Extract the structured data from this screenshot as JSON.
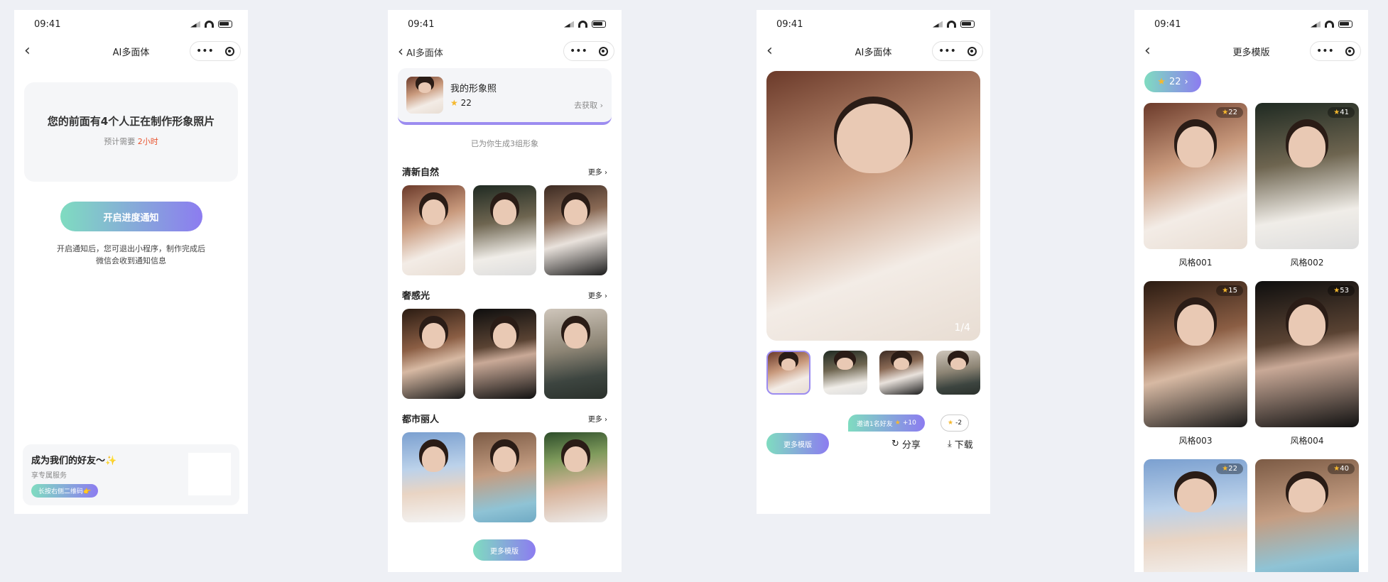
{
  "status": {
    "time": "09:41"
  },
  "screen1": {
    "title": "AI多面体",
    "queue_text": "您的前面有4个人正在制作形象照片",
    "estimate_prefix": "预计需要",
    "estimate_value": "2小时",
    "notify_button": "开启进度通知",
    "notify_desc_line1": "开启通知后，您可退出小程序，制作完成后",
    "notify_desc_line2": "微信会收到通知信息",
    "friend_title": "成为我们的好友～✨",
    "friend_sub": "享专属服务",
    "friend_button": "长按右侧二维码👉"
  },
  "screen2": {
    "title": "AI多面体",
    "profile_label": "我的形象照",
    "stars": "22",
    "get_more": "去获取",
    "generated": "已为你生成3组形象",
    "more": "更多",
    "sections": [
      {
        "title": "清新自然"
      },
      {
        "title": "奢感光"
      },
      {
        "title": "都市丽人"
      }
    ],
    "more_templates": "更多模版"
  },
  "screen3": {
    "title": "AI多面体",
    "counter": "1/4",
    "invite": "邀请1名好友",
    "invite_bonus": "+10",
    "cost": "-2",
    "more_templates": "更多模版",
    "share": "分享",
    "download": "下载"
  },
  "screen4": {
    "title": "更多模版",
    "stars": "22",
    "cards": [
      {
        "label": "风格001",
        "stars": "22"
      },
      {
        "label": "风格002",
        "stars": "41"
      },
      {
        "label": "风格003",
        "stars": "15"
      },
      {
        "label": "风格004",
        "stars": "53"
      },
      {
        "label": "",
        "stars": "22"
      },
      {
        "label": "",
        "stars": "40"
      }
    ]
  },
  "colors": {
    "accent_start": "#7fdcc0",
    "accent_end": "#8c7cf0",
    "highlight": "#e8542f"
  }
}
